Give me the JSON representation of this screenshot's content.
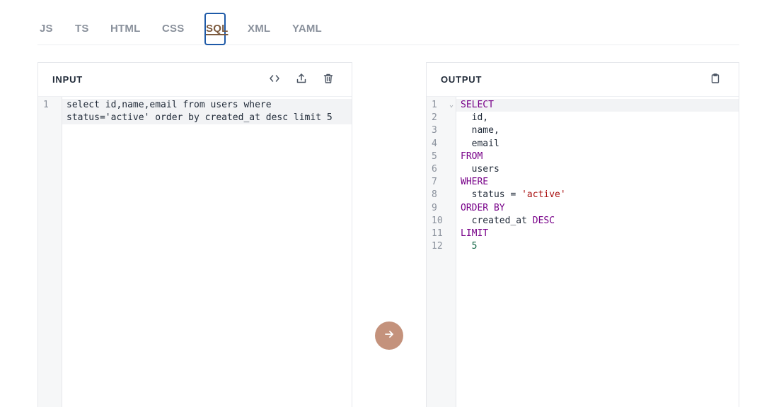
{
  "tabs": [
    {
      "label": "JS"
    },
    {
      "label": "TS"
    },
    {
      "label": "HTML"
    },
    {
      "label": "CSS"
    },
    {
      "label": "SQL",
      "active": true
    },
    {
      "label": "XML"
    },
    {
      "label": "YAML"
    }
  ],
  "input": {
    "title": "INPUT",
    "line_numbers": [
      "1"
    ],
    "lines": [
      "select id,name,email from users where",
      "status='active' order by created_at desc limit 5"
    ]
  },
  "output": {
    "title": "OUTPUT",
    "line_numbers": [
      "1",
      "2",
      "3",
      "4",
      "5",
      "6",
      "7",
      "8",
      "9",
      "10",
      "11",
      "12"
    ],
    "lines": [
      [
        {
          "t": "SELECT",
          "c": "kw"
        }
      ],
      [
        {
          "t": "  id,"
        }
      ],
      [
        {
          "t": "  name,"
        }
      ],
      [
        {
          "t": "  email"
        }
      ],
      [
        {
          "t": "FROM",
          "c": "kw"
        }
      ],
      [
        {
          "t": "  users"
        }
      ],
      [
        {
          "t": "WHERE",
          "c": "kw"
        }
      ],
      [
        {
          "t": "  status = "
        },
        {
          "t": "'active'",
          "c": "str"
        }
      ],
      [
        {
          "t": "ORDER BY",
          "c": "kw"
        }
      ],
      [
        {
          "t": "  created_at "
        },
        {
          "t": "DESC",
          "c": "kw"
        }
      ],
      [
        {
          "t": "LIMIT",
          "c": "kw"
        }
      ],
      [
        {
          "t": "  "
        },
        {
          "t": "5",
          "c": "num"
        }
      ]
    ]
  },
  "icons": {
    "format": "code-icon",
    "upload": "upload-icon",
    "delete": "trash-icon",
    "copy": "clipboard-icon",
    "convert": "arrow-right-icon"
  },
  "colors": {
    "accent": "#c4927c",
    "active_tab_border": "#1e5aa8",
    "keyword": "#770088",
    "string": "#aa1111",
    "number": "#116644"
  }
}
